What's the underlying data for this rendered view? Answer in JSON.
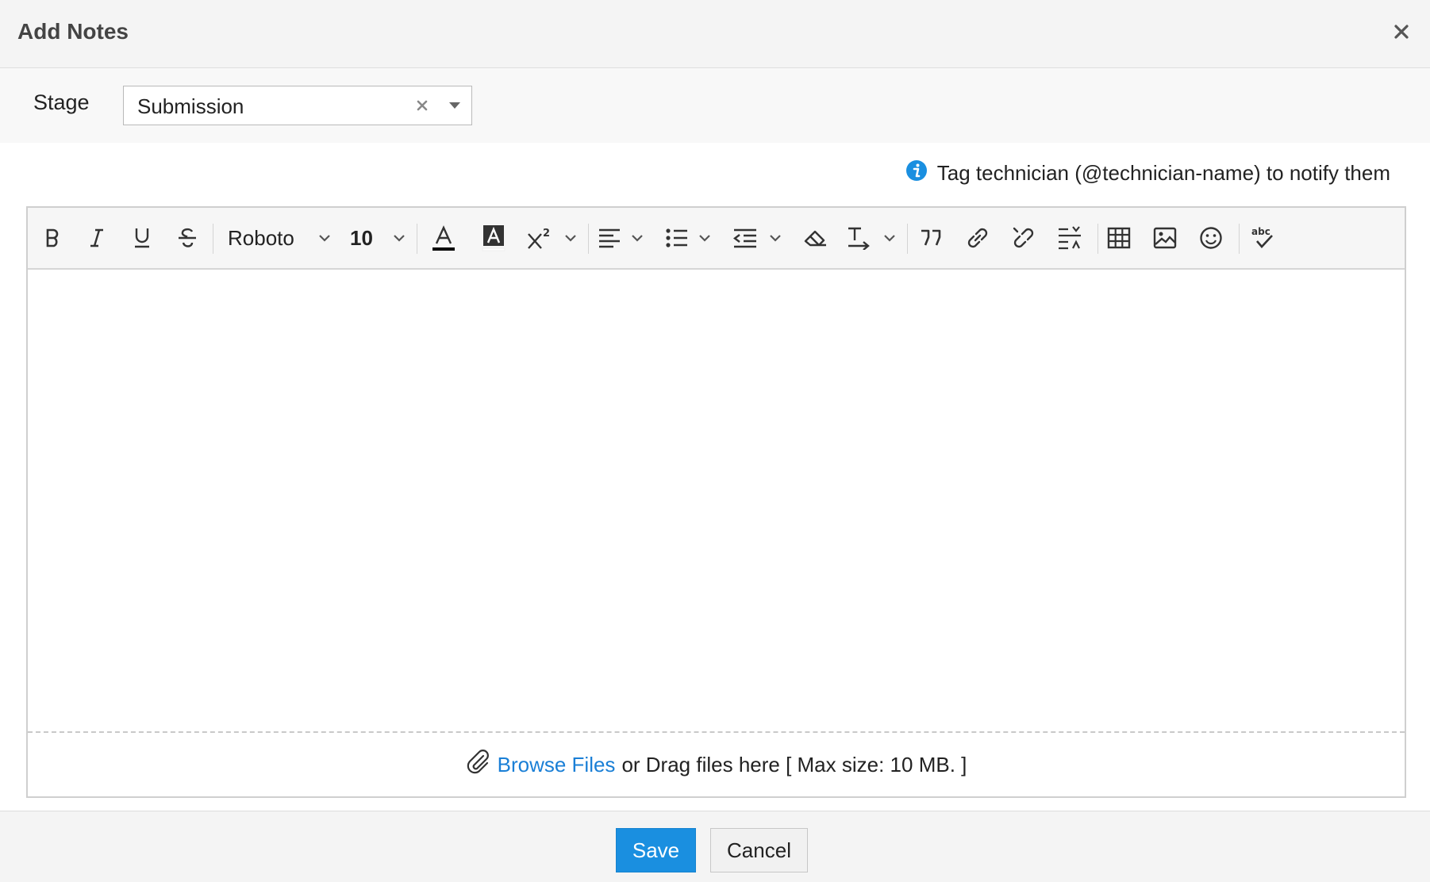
{
  "dialog": {
    "title": "Add Notes",
    "close_icon": "close-icon"
  },
  "stage": {
    "label": "Stage",
    "selected": "Submission",
    "clear_icon": "clear-icon",
    "dropdown_icon": "caret-down-icon"
  },
  "info": {
    "icon": "info-icon",
    "text": "Tag technician (@technician-name) to notify them"
  },
  "toolbar": {
    "font_family": "Roboto",
    "font_size": "10",
    "tools": [
      "bold-icon",
      "italic-icon",
      "underline-icon",
      "strikethrough-icon",
      "text-color-icon",
      "highlight-color-icon",
      "superscript-icon",
      "align-left-icon",
      "bullet-list-icon",
      "indent-icon",
      "eraser-icon",
      "text-direction-icon",
      "quote-icon",
      "link-icon",
      "unlink-icon",
      "line-height-icon",
      "table-icon",
      "image-icon",
      "emoji-icon",
      "spellcheck-icon"
    ],
    "colors": {
      "text_underline": "#000000"
    }
  },
  "attach": {
    "icon": "paperclip-icon",
    "browse_link": "Browse Files",
    "text": "or Drag files here [ Max size: 10 MB. ]"
  },
  "footer": {
    "save_label": "Save",
    "cancel_label": "Cancel"
  },
  "colors": {
    "accent": "#1a8fe0",
    "link": "#1a7fd6",
    "header_bg": "#f4f4f4"
  }
}
